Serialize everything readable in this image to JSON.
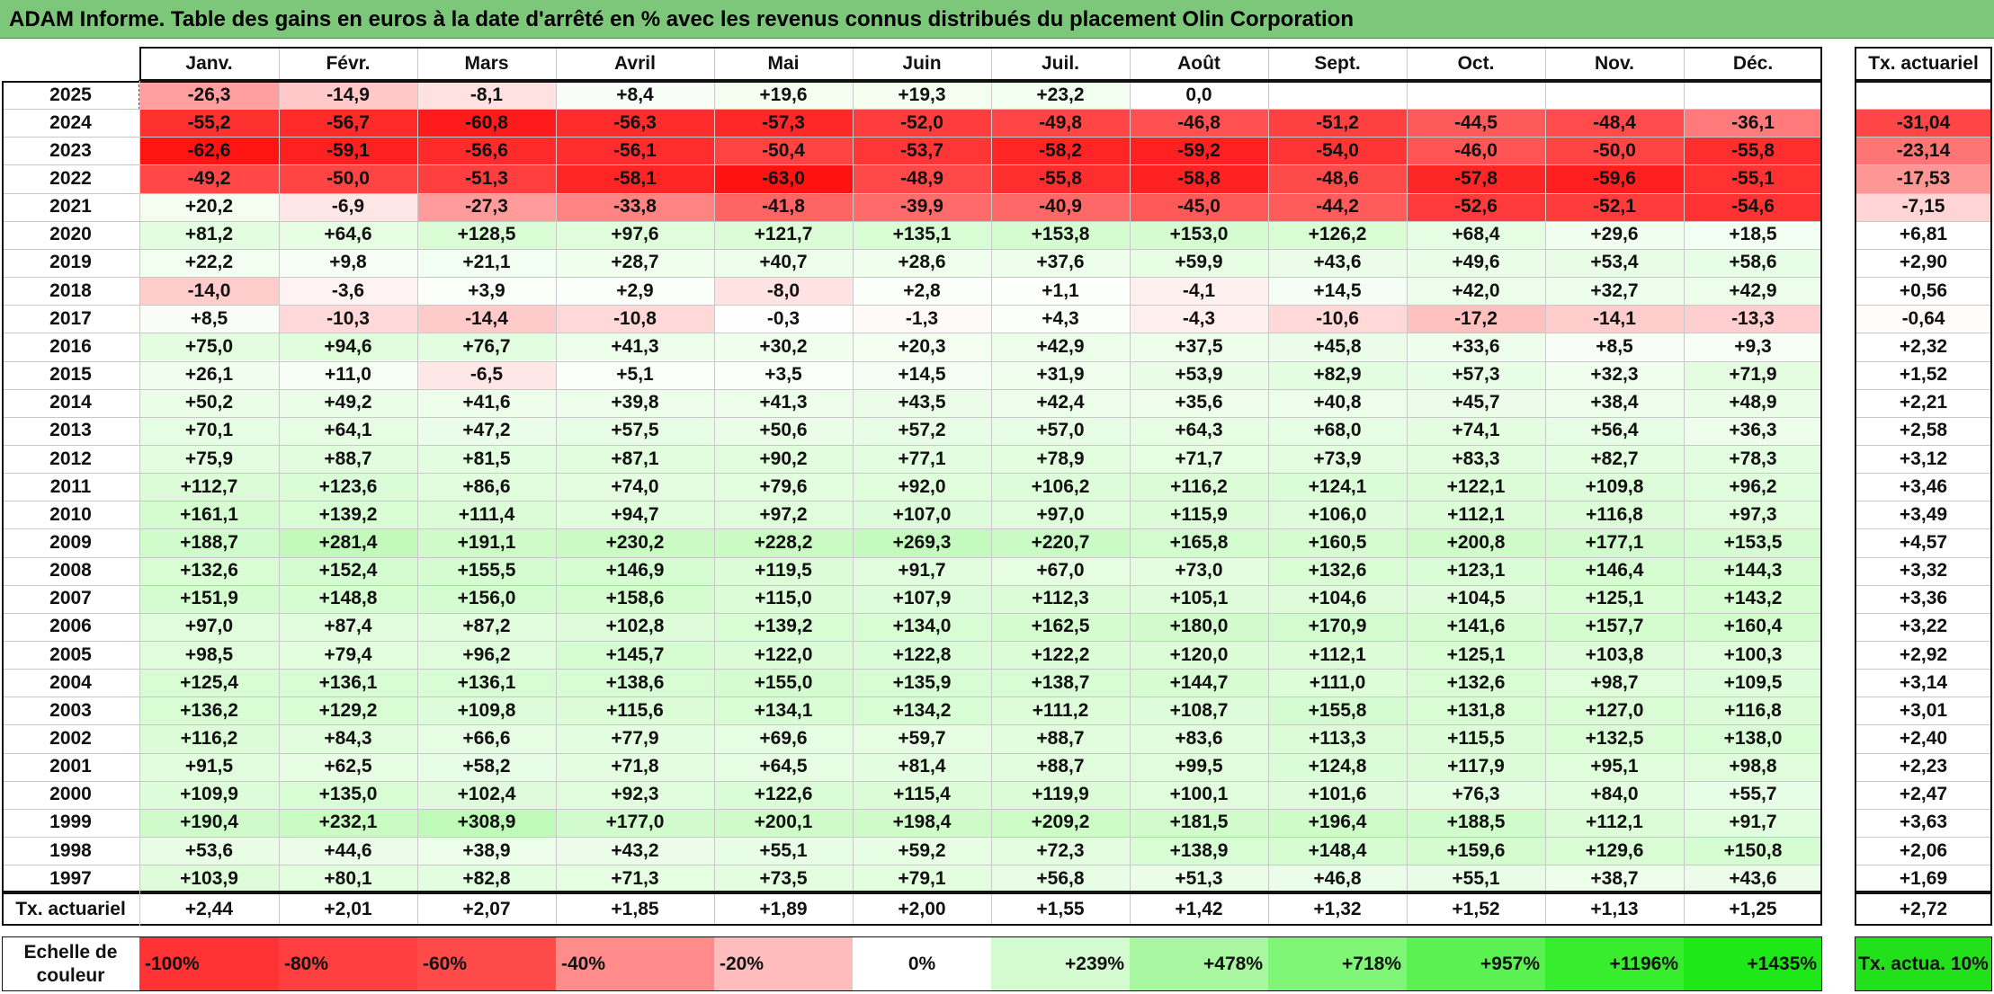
{
  "title": "ADAM Informe. Table des gains en euros à la date d'arrêté en % avec les revenus connus distribués du placement Olin Corporation",
  "columns": [
    "Janv.",
    "Févr.",
    "Mars",
    "Avril",
    "Mai",
    "Juin",
    "Juil.",
    "Août",
    "Sept.",
    "Oct.",
    "Nov.",
    "Déc."
  ],
  "rate_header": "Tx. actuariel",
  "rows": [
    {
      "year": "2025",
      "values": [
        "-26,3",
        "-14,9",
        "-8,1",
        "+8,4",
        "+19,6",
        "+19,3",
        "+23,2",
        "0,0",
        "",
        "",
        "",
        ""
      ],
      "rate": ""
    },
    {
      "year": "2024",
      "values": [
        "-55,2",
        "-56,7",
        "-60,8",
        "-56,3",
        "-57,3",
        "-52,0",
        "-49,8",
        "-46,8",
        "-51,2",
        "-44,5",
        "-48,4",
        "-36,1"
      ],
      "rate": "-31,04"
    },
    {
      "year": "2023",
      "values": [
        "-62,6",
        "-59,1",
        "-56,6",
        "-56,1",
        "-50,4",
        "-53,7",
        "-58,2",
        "-59,2",
        "-54,0",
        "-46,0",
        "-50,0",
        "-55,8"
      ],
      "rate": "-23,14"
    },
    {
      "year": "2022",
      "values": [
        "-49,2",
        "-50,0",
        "-51,3",
        "-58,1",
        "-63,0",
        "-48,9",
        "-55,8",
        "-58,8",
        "-48,6",
        "-57,8",
        "-59,6",
        "-55,1"
      ],
      "rate": "-17,53"
    },
    {
      "year": "2021",
      "values": [
        "+20,2",
        "-6,9",
        "-27,3",
        "-33,8",
        "-41,8",
        "-39,9",
        "-40,9",
        "-45,0",
        "-44,2",
        "-52,6",
        "-52,1",
        "-54,6"
      ],
      "rate": "-7,15"
    },
    {
      "year": "2020",
      "values": [
        "+81,2",
        "+64,6",
        "+128,5",
        "+97,6",
        "+121,7",
        "+135,1",
        "+153,8",
        "+153,0",
        "+126,2",
        "+68,4",
        "+29,6",
        "+18,5"
      ],
      "rate": "+6,81"
    },
    {
      "year": "2019",
      "values": [
        "+22,2",
        "+9,8",
        "+21,1",
        "+28,7",
        "+40,7",
        "+28,6",
        "+37,6",
        "+59,9",
        "+43,6",
        "+49,6",
        "+53,4",
        "+58,6"
      ],
      "rate": "+2,90"
    },
    {
      "year": "2018",
      "values": [
        "-14,0",
        "-3,6",
        "+3,9",
        "+2,9",
        "-8,0",
        "+2,8",
        "+1,1",
        "-4,1",
        "+14,5",
        "+42,0",
        "+32,7",
        "+42,9"
      ],
      "rate": "+0,56"
    },
    {
      "year": "2017",
      "values": [
        "+8,5",
        "-10,3",
        "-14,4",
        "-10,8",
        "-0,3",
        "-1,3",
        "+4,3",
        "-4,3",
        "-10,6",
        "-17,2",
        "-14,1",
        "-13,3"
      ],
      "rate": "-0,64"
    },
    {
      "year": "2016",
      "values": [
        "+75,0",
        "+94,6",
        "+76,7",
        "+41,3",
        "+30,2",
        "+20,3",
        "+42,9",
        "+37,5",
        "+45,8",
        "+33,6",
        "+8,5",
        "+9,3"
      ],
      "rate": "+2,32"
    },
    {
      "year": "2015",
      "values": [
        "+26,1",
        "+11,0",
        "-6,5",
        "+5,1",
        "+3,5",
        "+14,5",
        "+31,9",
        "+53,9",
        "+82,9",
        "+57,3",
        "+32,3",
        "+71,9"
      ],
      "rate": "+1,52"
    },
    {
      "year": "2014",
      "values": [
        "+50,2",
        "+49,2",
        "+41,6",
        "+39,8",
        "+41,3",
        "+43,5",
        "+42,4",
        "+35,6",
        "+40,8",
        "+45,7",
        "+38,4",
        "+48,9"
      ],
      "rate": "+2,21"
    },
    {
      "year": "2013",
      "values": [
        "+70,1",
        "+64,1",
        "+47,2",
        "+57,5",
        "+50,6",
        "+57,2",
        "+57,0",
        "+64,3",
        "+68,0",
        "+74,1",
        "+56,4",
        "+36,3"
      ],
      "rate": "+2,58"
    },
    {
      "year": "2012",
      "values": [
        "+75,9",
        "+88,7",
        "+81,5",
        "+87,1",
        "+90,2",
        "+77,1",
        "+78,9",
        "+71,7",
        "+73,9",
        "+83,3",
        "+82,7",
        "+78,3"
      ],
      "rate": "+3,12"
    },
    {
      "year": "2011",
      "values": [
        "+112,7",
        "+123,6",
        "+86,6",
        "+74,0",
        "+79,6",
        "+92,0",
        "+106,2",
        "+116,2",
        "+124,1",
        "+122,1",
        "+109,8",
        "+96,2"
      ],
      "rate": "+3,46"
    },
    {
      "year": "2010",
      "values": [
        "+161,1",
        "+139,2",
        "+111,4",
        "+94,7",
        "+97,2",
        "+107,0",
        "+97,0",
        "+115,9",
        "+106,0",
        "+112,1",
        "+116,8",
        "+97,3"
      ],
      "rate": "+3,49"
    },
    {
      "year": "2009",
      "values": [
        "+188,7",
        "+281,4",
        "+191,1",
        "+230,2",
        "+228,2",
        "+269,3",
        "+220,7",
        "+165,8",
        "+160,5",
        "+200,8",
        "+177,1",
        "+153,5"
      ],
      "rate": "+4,57"
    },
    {
      "year": "2008",
      "values": [
        "+132,6",
        "+152,4",
        "+155,5",
        "+146,9",
        "+119,5",
        "+91,7",
        "+67,0",
        "+73,0",
        "+132,6",
        "+123,1",
        "+146,4",
        "+144,3"
      ],
      "rate": "+3,32"
    },
    {
      "year": "2007",
      "values": [
        "+151,9",
        "+148,8",
        "+156,0",
        "+158,6",
        "+115,0",
        "+107,9",
        "+112,3",
        "+105,1",
        "+104,6",
        "+104,5",
        "+125,1",
        "+143,2"
      ],
      "rate": "+3,36"
    },
    {
      "year": "2006",
      "values": [
        "+97,0",
        "+87,4",
        "+87,2",
        "+102,8",
        "+139,2",
        "+134,0",
        "+162,5",
        "+180,0",
        "+170,9",
        "+141,6",
        "+157,7",
        "+160,4"
      ],
      "rate": "+3,22"
    },
    {
      "year": "2005",
      "values": [
        "+98,5",
        "+79,4",
        "+96,2",
        "+145,7",
        "+122,0",
        "+122,8",
        "+122,2",
        "+120,0",
        "+112,1",
        "+125,1",
        "+103,8",
        "+100,3"
      ],
      "rate": "+2,92"
    },
    {
      "year": "2004",
      "values": [
        "+125,4",
        "+136,1",
        "+136,1",
        "+138,6",
        "+155,0",
        "+135,9",
        "+138,7",
        "+144,7",
        "+111,0",
        "+132,6",
        "+98,7",
        "+109,5"
      ],
      "rate": "+3,14"
    },
    {
      "year": "2003",
      "values": [
        "+136,2",
        "+129,2",
        "+109,8",
        "+115,6",
        "+134,1",
        "+134,2",
        "+111,2",
        "+108,7",
        "+155,8",
        "+131,8",
        "+127,0",
        "+116,8"
      ],
      "rate": "+3,01"
    },
    {
      "year": "2002",
      "values": [
        "+116,2",
        "+84,3",
        "+66,6",
        "+77,9",
        "+69,6",
        "+59,7",
        "+88,7",
        "+83,6",
        "+113,3",
        "+115,5",
        "+132,5",
        "+138,0"
      ],
      "rate": "+2,40"
    },
    {
      "year": "2001",
      "values": [
        "+91,5",
        "+62,5",
        "+58,2",
        "+71,8",
        "+64,5",
        "+81,4",
        "+88,7",
        "+99,5",
        "+124,8",
        "+117,9",
        "+95,1",
        "+98,8"
      ],
      "rate": "+2,23"
    },
    {
      "year": "2000",
      "values": [
        "+109,9",
        "+135,0",
        "+102,4",
        "+92,3",
        "+122,6",
        "+115,4",
        "+119,9",
        "+100,1",
        "+101,6",
        "+76,3",
        "+84,0",
        "+55,7"
      ],
      "rate": "+2,47"
    },
    {
      "year": "1999",
      "values": [
        "+190,4",
        "+232,1",
        "+308,9",
        "+177,0",
        "+200,1",
        "+198,4",
        "+209,2",
        "+181,5",
        "+196,4",
        "+188,5",
        "+112,1",
        "+91,7"
      ],
      "rate": "+3,63"
    },
    {
      "year": "1998",
      "values": [
        "+53,6",
        "+44,6",
        "+38,9",
        "+43,2",
        "+55,1",
        "+59,2",
        "+72,3",
        "+138,9",
        "+148,4",
        "+159,6",
        "+129,6",
        "+150,8"
      ],
      "rate": "+2,06"
    },
    {
      "year": "1997",
      "values": [
        "+103,9",
        "+80,1",
        "+82,8",
        "+71,3",
        "+73,5",
        "+79,1",
        "+56,8",
        "+51,3",
        "+46,8",
        "+55,1",
        "+38,7",
        "+43,6"
      ],
      "rate": "+1,69"
    }
  ],
  "footer": {
    "label": "Tx. actuariel",
    "values": [
      "+2,44",
      "+2,01",
      "+2,07",
      "+1,85",
      "+1,89",
      "+2,00",
      "+1,55",
      "+1,42",
      "+1,32",
      "+1,52",
      "+1,13",
      "+1,25"
    ],
    "rate": "+2,72"
  },
  "scale": {
    "label": "Echelle de couleur",
    "items": [
      {
        "label": "-100%",
        "color": "#ff3333"
      },
      {
        "label": "-80%",
        "color": "#ff3f3f"
      },
      {
        "label": "-60%",
        "color": "#ff4a4a"
      },
      {
        "label": "-40%",
        "color": "#ff8b8b"
      },
      {
        "label": "-20%",
        "color": "#ffbcbc"
      },
      {
        "label": "0%",
        "color": "#ffffff"
      },
      {
        "label": "+239%",
        "color": "#d4fbd0"
      },
      {
        "label": "+478%",
        "color": "#a8f7a0"
      },
      {
        "label": "+718%",
        "color": "#7ff576"
      },
      {
        "label": "+957%",
        "color": "#5bf152"
      },
      {
        "label": "+1196%",
        "color": "#37ed2e"
      },
      {
        "label": "+1435%",
        "color": "#1fe818"
      }
    ],
    "rate_label": "Tx. actua. 10%",
    "rate_color": "#22e01a"
  }
}
